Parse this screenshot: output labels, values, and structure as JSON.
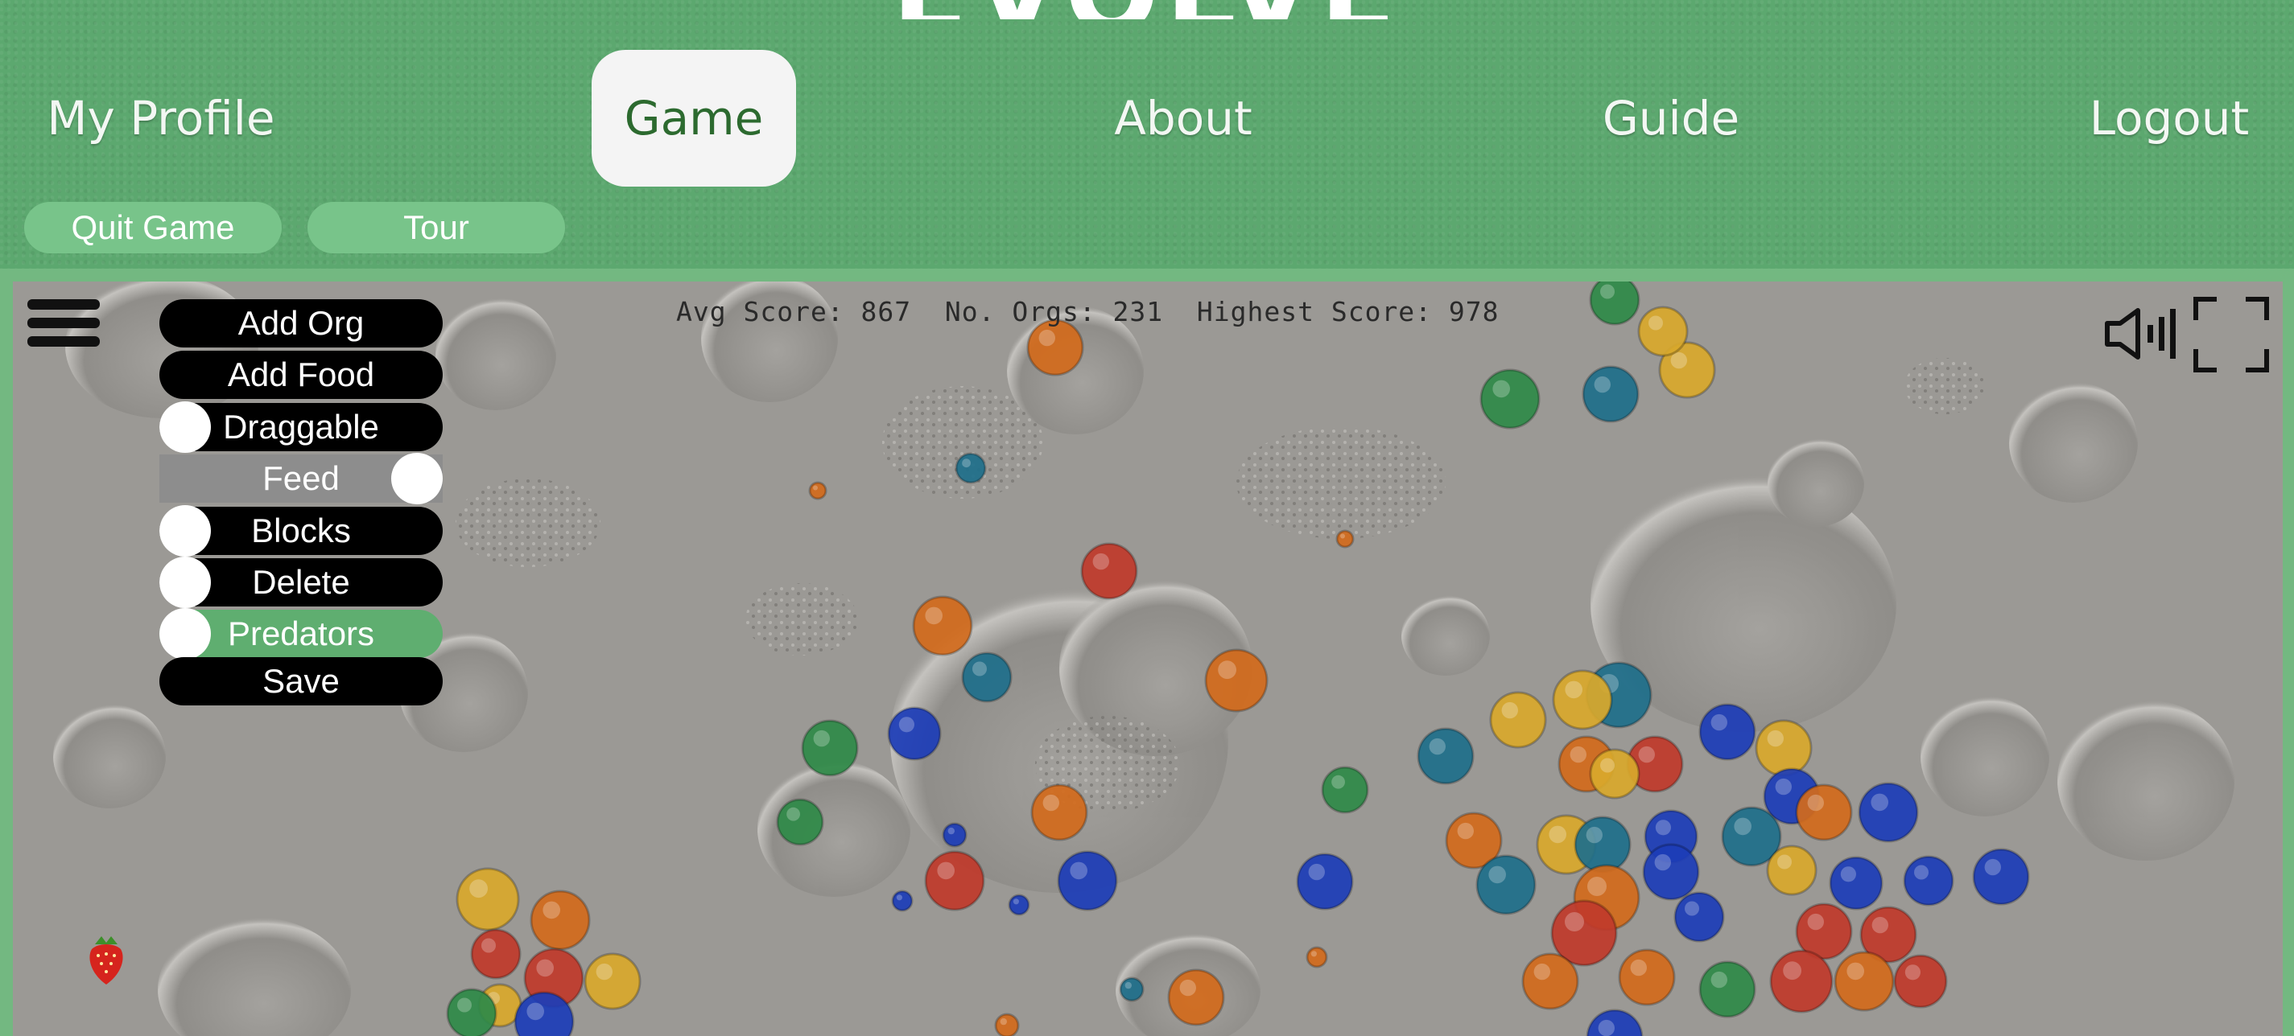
{
  "app": {
    "logo_text": "EVOLVE"
  },
  "nav": {
    "items": [
      {
        "label": "My Profile",
        "active": false
      },
      {
        "label": "Game",
        "active": true
      },
      {
        "label": "About",
        "active": false
      },
      {
        "label": "Guide",
        "active": false
      },
      {
        "label": "Logout",
        "active": false
      }
    ]
  },
  "toolbar": {
    "quit_label": "Quit Game",
    "tour_label": "Tour"
  },
  "stats": {
    "text": "Avg Score: 867  No. Orgs: 231  Highest Score: 978"
  },
  "menu": {
    "items": [
      {
        "label": "Add Org",
        "type": "button"
      },
      {
        "label": "Add Food",
        "type": "button"
      },
      {
        "label": "Draggable",
        "type": "toggle",
        "on": false
      },
      {
        "label": "Feed",
        "type": "toggle",
        "on": true
      },
      {
        "label": "Blocks",
        "type": "toggle",
        "on": false
      },
      {
        "label": "Delete",
        "type": "toggle",
        "on": false
      },
      {
        "label": "Predators",
        "type": "toggle",
        "on": false
      },
      {
        "label": "Save",
        "type": "button"
      }
    ]
  },
  "icons": {
    "hamburger": "menu-icon",
    "sound": "speaker-icon",
    "fullscreen": "fullscreen-icon",
    "food": "strawberry-icon"
  },
  "colors": {
    "header_bg": "#5ca86f",
    "nav_active_bg": "#f4f4f4",
    "pill_bg": "#78c48a",
    "menu_bg": "#000000",
    "toggle_on_bg": "#8d8d8d",
    "predators_bg": "#5fae70",
    "org_colors": [
      "#1f6f8b",
      "#d36b1c",
      "#c03a2b",
      "#d9a92c",
      "#1d3db8",
      "#2f8a48"
    ]
  }
}
